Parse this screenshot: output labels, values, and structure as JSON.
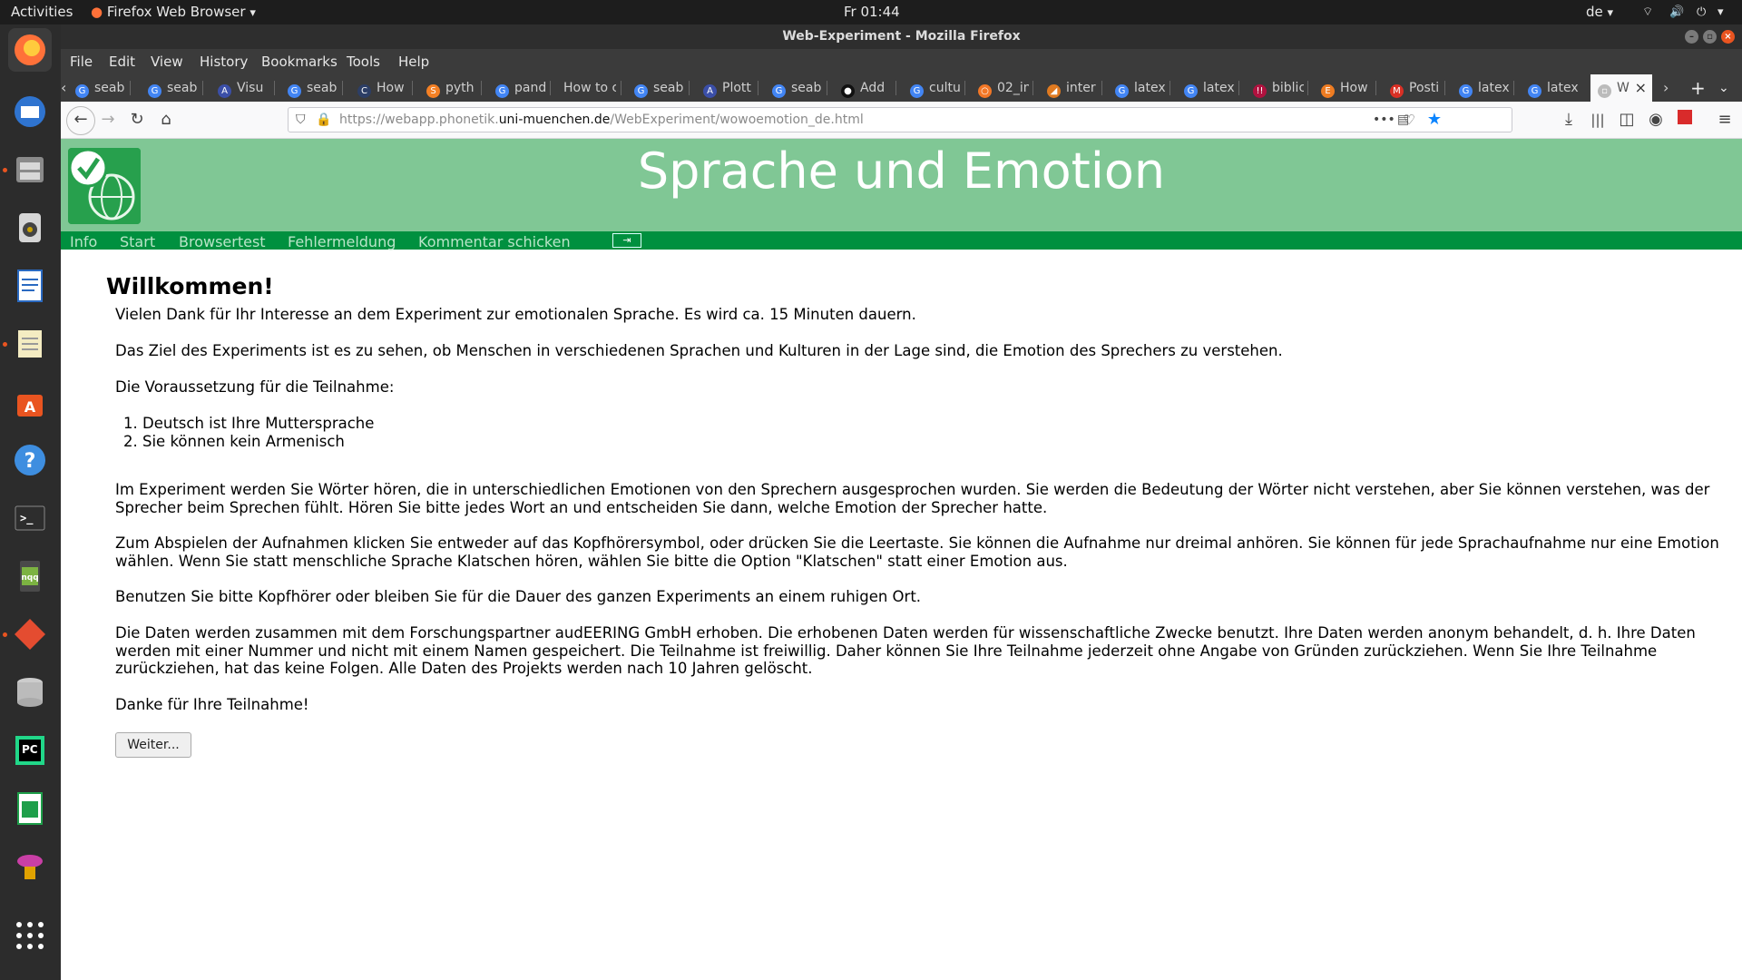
{
  "system": {
    "activities": "Activities",
    "app_name": "Firefox Web Browser",
    "clock": "Fr 01:44",
    "language": "de"
  },
  "window": {
    "title": "Web-Experiment - Mozilla Firefox"
  },
  "menu": [
    "File",
    "Edit",
    "View",
    "History",
    "Bookmarks",
    "Tools",
    "Help"
  ],
  "tabs": [
    {
      "label": "seab",
      "icon": "google-icon"
    },
    {
      "label": "seab",
      "icon": "google-icon"
    },
    {
      "label": "Visu",
      "icon": "a-icon"
    },
    {
      "label": "seab",
      "icon": "google-icon"
    },
    {
      "label": "How",
      "icon": "c-icon"
    },
    {
      "label": "pyth",
      "icon": "so-icon"
    },
    {
      "label": "pand",
      "icon": "google-icon"
    },
    {
      "label": "How to c",
      "icon": ""
    },
    {
      "label": "seab",
      "icon": "google-icon"
    },
    {
      "label": "Plott",
      "icon": "a-icon"
    },
    {
      "label": "seab",
      "icon": "google-icon"
    },
    {
      "label": "Add",
      "icon": "github-icon"
    },
    {
      "label": "cultu",
      "icon": "google-icon"
    },
    {
      "label": "02_in",
      "icon": "jupyter-icon"
    },
    {
      "label": "inter",
      "icon": "overleaf-icon"
    },
    {
      "label": "latex",
      "icon": "google-icon"
    },
    {
      "label": "latex",
      "icon": "google-icon"
    },
    {
      "label": "biblic",
      "icon": "tex-icon"
    },
    {
      "label": "How",
      "icon": "e-icon"
    },
    {
      "label": "Posti",
      "icon": "gmail-icon"
    },
    {
      "label": "latex",
      "icon": "google-icon"
    },
    {
      "label": "latex",
      "icon": "google-icon"
    },
    {
      "label": "W",
      "icon": "page-icon"
    }
  ],
  "url": {
    "prefix": "https://webapp.phonetik.",
    "host": "uni-muenchen.de",
    "path": "/WebExperiment/wowoemotion_de.html"
  },
  "site": {
    "title": "Sprache und Emotion",
    "nav": [
      "Info",
      "Start",
      "Browsertest",
      "Fehlermeldung",
      "Kommentar schicken"
    ]
  },
  "content": {
    "heading": "Willkommen!",
    "p1": "Vielen Dank für Ihr Interesse an dem Experiment zur emotionalen Sprache. Es wird ca. 15 Minuten dauern.",
    "p2": "Das Ziel des Experiments ist es zu sehen, ob Menschen in verschiedenen Sprachen und Kulturen in der Lage sind, die Emotion des Sprechers zu verstehen.",
    "p3": "Die Voraussetzung für die Teilnahme:",
    "conditions": [
      "Deutsch ist Ihre Muttersprache",
      "Sie können kein Armenisch"
    ],
    "p4": "Im Experiment werden Sie Wörter hören, die in unterschiedlichen Emotionen von den Sprechern ausgesprochen wurden. Sie werden die Bedeutung der Wörter nicht verstehen, aber Sie können verstehen, was der Sprecher beim Sprechen fühlt. Hören Sie bitte jedes Wort an und entscheiden Sie dann, welche Emotion der Sprecher hatte.",
    "p5": "Zum Abspielen der Aufnahmen klicken Sie entweder auf das Kopfhörersymbol, oder drücken Sie die Leertaste. Sie können die Aufnahme nur dreimal anhören. Sie können für jede Sprachaufnahme nur eine Emotion wählen. Wenn Sie statt menschliche Sprache Klatschen hören, wählen Sie bitte die Option \"Klatschen\" statt einer Emotion aus.",
    "p6": "Benutzen Sie bitte Kopfhörer oder bleiben Sie für die Dauer des ganzen Experiments an einem ruhigen Ort.",
    "p7": "Die Daten werden zusammen mit dem Forschungspartner audEERING GmbH erhoben. Die erhobenen Daten werden für wissenschaftliche Zwecke benutzt. Ihre Daten werden anonym behandelt, d. h. Ihre Daten werden mit einer Nummer und nicht mit einem Namen gespeichert. Die Teilnahme ist freiwillig. Daher können Sie Ihre Teilnahme jederzeit ohne Angabe von Gründen zurückziehen. Wenn Sie Ihre Teilnahme zurückziehen, hat das keine Folgen. Alle Daten des Projekts werden nach 10 Jahren gelöscht.",
    "p8": "Danke für Ihre Teilnahme!",
    "button": "Weiter..."
  },
  "colors": {
    "banner": "#80c795",
    "nav_bar": "#00903f",
    "nav_link": "#b9e4c7"
  }
}
